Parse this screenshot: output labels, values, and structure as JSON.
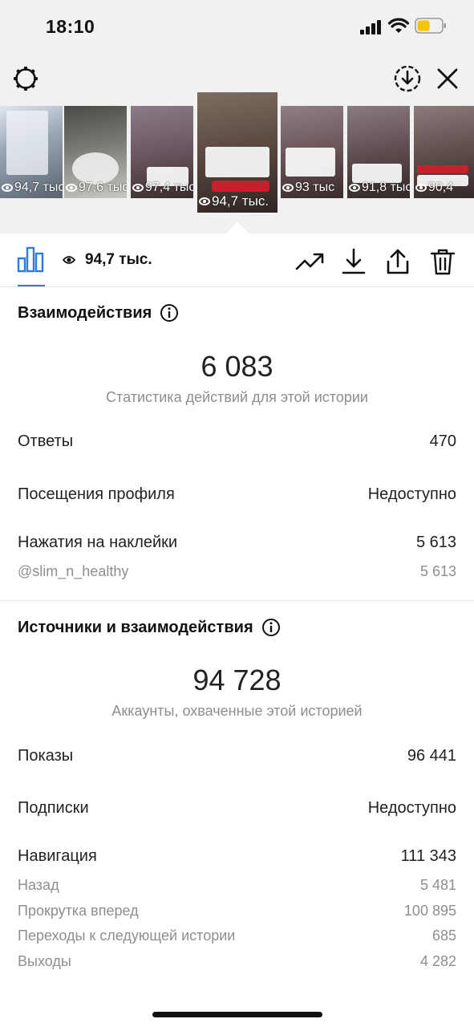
{
  "status": {
    "time": "18:10"
  },
  "stories": [
    {
      "views": "94,7 тыс"
    },
    {
      "views": "97,6 тыс"
    },
    {
      "views": "97,4 тыс"
    },
    {
      "views": "94,7 тыс."
    },
    {
      "views": "93 тыс"
    },
    {
      "views": "91,8 тыс"
    },
    {
      "views": "90,4"
    }
  ],
  "toolbar": {
    "views": "94,7 тыс."
  },
  "interactions": {
    "title": "Взаимодействия",
    "total": "6 083",
    "subtitle": "Статистика действий для этой истории",
    "rows": [
      {
        "label": "Ответы",
        "value": "470"
      },
      {
        "label": "Посещения профиля",
        "value": "Недоступно"
      },
      {
        "label": "Нажатия на наклейки",
        "value": "5 613"
      }
    ],
    "sticker": {
      "label": "@slim_n_healthy",
      "value": "5 613"
    }
  },
  "discovery": {
    "title": "Источники и взаимодействия",
    "total": "94 728",
    "subtitle": "Аккаунты, охваченные этой историей",
    "rows": [
      {
        "label": "Показы",
        "value": "96 441"
      },
      {
        "label": "Подписки",
        "value": "Недоступно"
      },
      {
        "label": "Навигация",
        "value": "111 343"
      }
    ],
    "nav": [
      {
        "label": "Назад",
        "value": "5 481"
      },
      {
        "label": "Прокрутка вперед",
        "value": "100 895"
      },
      {
        "label": "Переходы к следующей истории",
        "value": "685"
      },
      {
        "label": "Выходы",
        "value": "4 282"
      }
    ]
  }
}
